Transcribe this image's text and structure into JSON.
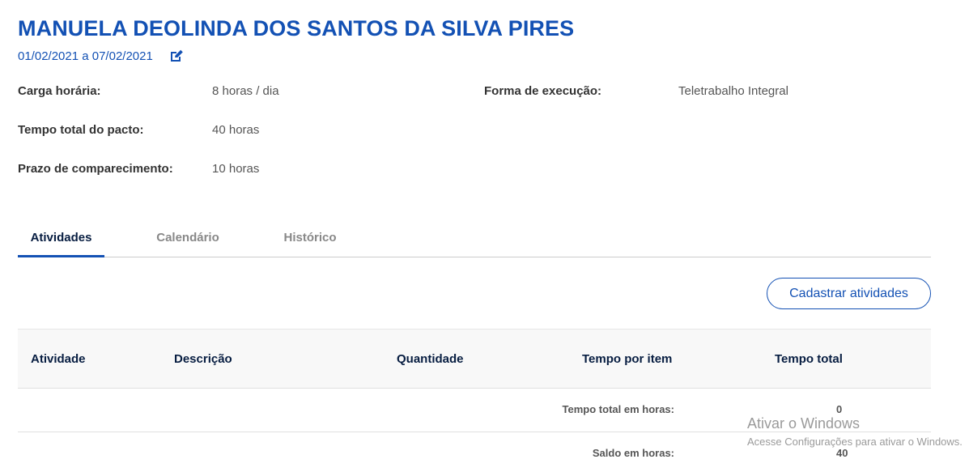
{
  "header": {
    "name": "MANUELA DEOLINDA DOS SANTOS DA SILVA PIRES",
    "period": "01/02/2021 a 07/02/2021",
    "edit_icon": "edit-icon"
  },
  "details": {
    "carga_label": "Carga horária:",
    "carga_value": "8 horas / dia",
    "forma_label": "Forma de execução:",
    "forma_value": "Teletrabalho Integral",
    "tempo_label": "Tempo total do pacto:",
    "tempo_value": "40 horas",
    "prazo_label": "Prazo de comparecimento:",
    "prazo_value": "10 horas"
  },
  "tabs": [
    {
      "label": "Atividades",
      "active": true
    },
    {
      "label": "Calendário",
      "active": false
    },
    {
      "label": "Histórico",
      "active": false
    }
  ],
  "actions": {
    "cadastrar_label": "Cadastrar atividades"
  },
  "table": {
    "columns": [
      "Atividade",
      "Descrição",
      "Quantidade",
      "Tempo por item",
      "Tempo total"
    ],
    "summary": [
      {
        "label": "Tempo total em horas:",
        "value": "0"
      },
      {
        "label": "Saldo em horas:",
        "value": "40"
      }
    ]
  },
  "watermark": {
    "title": "Ativar o Windows",
    "subtitle": "Acesse Configurações para ativar o Windows."
  },
  "colors": {
    "primary": "#1351b4",
    "heading_dark": "#071d41"
  }
}
